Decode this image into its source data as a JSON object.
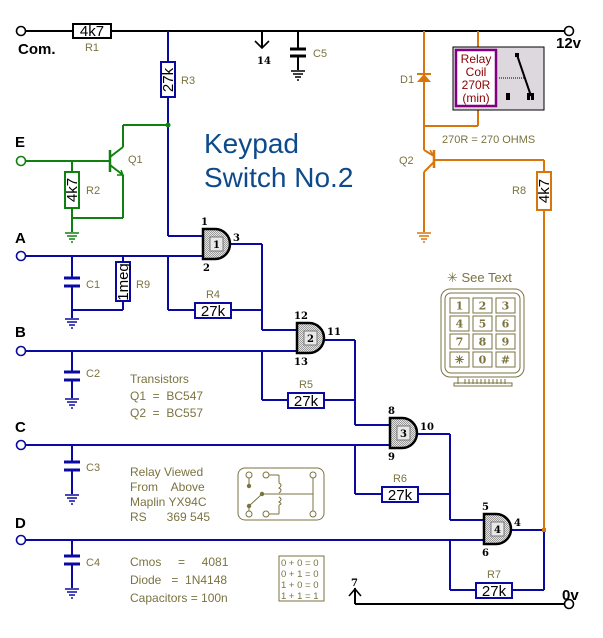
{
  "title": {
    "line1": "Keypad",
    "line2": "Switch No.2"
  },
  "colors": {
    "title": "#0d4a8c",
    "logic_wire": "#0a0aa0",
    "supply_wire": "#000000",
    "transistor_q1": "#108010",
    "relay_circuit": "#d8760c",
    "annotation": "#7b7340",
    "relay_coil_border": "#800080",
    "relay_coil_text": "#8b0000",
    "relay_box_fill": "#ddd8de"
  },
  "terminals": {
    "com": "Com.",
    "v12": "12v",
    "v0": "0v",
    "inputs": [
      "E",
      "A",
      "B",
      "C",
      "D"
    ]
  },
  "supply_pins": {
    "vdd": "14",
    "vss": "7"
  },
  "resistors": [
    {
      "ref": "R1",
      "value": "4k7"
    },
    {
      "ref": "R2",
      "value": "4k7"
    },
    {
      "ref": "R3",
      "value": "27k"
    },
    {
      "ref": "R4",
      "value": "27k"
    },
    {
      "ref": "R5",
      "value": "27k"
    },
    {
      "ref": "R6",
      "value": "27k"
    },
    {
      "ref": "R7",
      "value": "27k"
    },
    {
      "ref": "R8",
      "value": "4k7"
    },
    {
      "ref": "R9",
      "value": "1meg"
    }
  ],
  "capacitors": [
    "C1",
    "C2",
    "C3",
    "C4",
    "C5"
  ],
  "transistors": [
    "Q1",
    "Q2"
  ],
  "diode": "D1",
  "gates": [
    {
      "id": "1",
      "in_a": "1",
      "in_b": "2",
      "out": "3"
    },
    {
      "id": "2",
      "in_a": "12",
      "in_b": "13",
      "out": "11"
    },
    {
      "id": "3",
      "in_a": "8",
      "in_b": "9",
      "out": "10"
    },
    {
      "id": "4",
      "in_a": "5",
      "in_b": "6",
      "out": "4"
    }
  ],
  "relay": {
    "line1": "Relay",
    "line2": "Coil",
    "line3": "270R",
    "line4": "(min)"
  },
  "notes": {
    "ohms": "270R = 270 OHMS",
    "see_text": "✳ See Text",
    "transistors": [
      "Transistors",
      "Q1  =  BC547",
      "Q2  =  BC557"
    ],
    "relay_view": [
      "Relay Viewed",
      "From    Above",
      "Maplin YX94C",
      "RS      369 545"
    ],
    "parts": [
      "Cmos     =     4081",
      "Diode   =  1N4148",
      "Capacitors = 100n"
    ],
    "truth_table": [
      "0 + 0 = 0",
      "0 + 1 = 0",
      "1 + 0 = 0",
      "1 + 1 = 1"
    ]
  },
  "keypad": {
    "keys": [
      "1",
      "2",
      "3",
      "4",
      "5",
      "6",
      "7",
      "8",
      "9",
      "✳",
      "0",
      "#"
    ]
  }
}
